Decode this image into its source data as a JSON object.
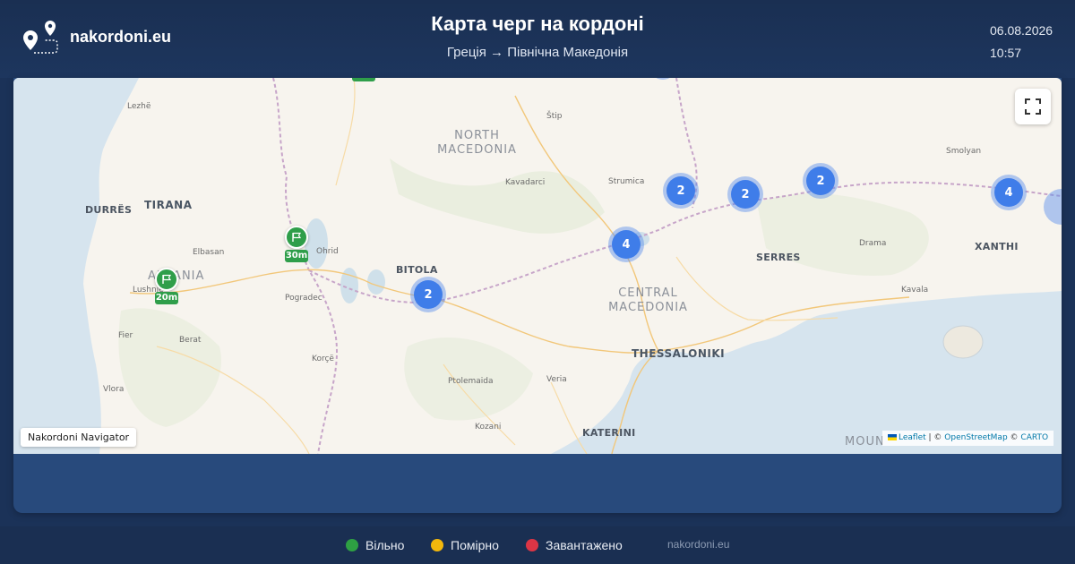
{
  "brand": {
    "name": "nakordoni.eu",
    "logo_icon": "route-pins-icon"
  },
  "header": {
    "title": "Карта черг на кордоні",
    "subtitle": "Греція → Північна Македонія",
    "date": "06.08.2026",
    "time": "10:57"
  },
  "map": {
    "nav_badge": "Nakordoni Navigator",
    "attribution": {
      "leaflet": "Leaflet",
      "sep1": " | © ",
      "osm": "OpenStreetMap",
      "sep2": " © ",
      "carto": "CARTO"
    },
    "fullscreen_icon": "fullscreen-icon",
    "labels": {
      "lezhe": "Lezhë",
      "durres": "DURRËS",
      "tirana": "TIRANA",
      "elbasan": "Elbasan",
      "albania": "ALBANIA",
      "lushnje": "Lushnje",
      "fier": "Fier",
      "berat": "Berat",
      "vlora": "Vlora",
      "ohrid": "Ohrid",
      "pogradec": "Pogradec",
      "korce": "Korçë",
      "stip": "Štip",
      "north_macedonia_1": "NORTH",
      "north_macedonia_2": "MACEDONIA",
      "kavadarci": "Kavadarci",
      "strumica": "Strumica",
      "bitola": "BITOLA",
      "central_macedonia_1": "CENTRAL",
      "central_macedonia_2": "MACEDONIA",
      "thessaloniki": "THESSALONIKI",
      "ptolemaida": "Ptolemaida",
      "veria": "Veria",
      "kozani": "Kozani",
      "katerini": "KATERINI",
      "serres": "SERRES",
      "drama": "Drama",
      "kavala": "Kavala",
      "xanthi": "XANTHI",
      "smolyan": "Smolyan",
      "mount": "MOUN"
    },
    "clusters": [
      "2",
      "2",
      "2",
      "4",
      "4",
      "2"
    ],
    "markers": [
      {
        "label": "30m",
        "status": "free"
      },
      {
        "label": "20m",
        "status": "free"
      }
    ]
  },
  "legend": {
    "items": [
      {
        "label": "Вільно",
        "color": "#2ea043"
      },
      {
        "label": "Помірно",
        "color": "#f2b70c"
      },
      {
        "label": "Завантажено",
        "color": "#dc3545"
      }
    ],
    "site": "nakordoni.eu"
  }
}
